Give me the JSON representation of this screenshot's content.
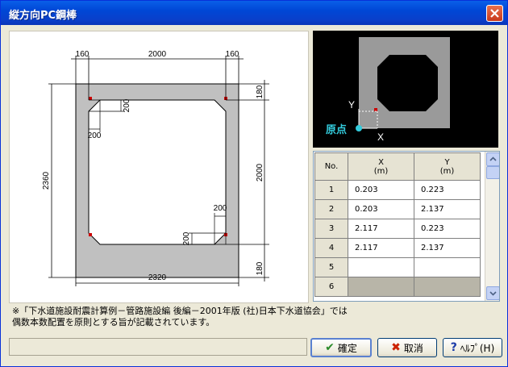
{
  "window": {
    "title": "縦方向PC鋼棒"
  },
  "drawing": {
    "dims": {
      "top_left": "160",
      "top_mid": "2000",
      "top_right": "160",
      "left": "2360",
      "right_top": "180",
      "right_mid": "2000",
      "right_bottom": "180",
      "bottom": "2320",
      "chamfer_tl_v": "200",
      "chamfer_tl_h": "200",
      "chamfer_br_h": "200",
      "chamfer_br_v": "200"
    }
  },
  "preview": {
    "origin_label": "原点",
    "axis_x": "X",
    "axis_y": "Y"
  },
  "table": {
    "headers": {
      "no": "No.",
      "x": "X",
      "x_unit": "(m)",
      "y": "Y",
      "y_unit": "(m)"
    },
    "rows": [
      {
        "no": "1",
        "x": "0.203",
        "y": "0.223"
      },
      {
        "no": "2",
        "x": "0.203",
        "y": "2.137"
      },
      {
        "no": "3",
        "x": "2.117",
        "y": "0.223"
      },
      {
        "no": "4",
        "x": "2.117",
        "y": "2.137"
      },
      {
        "no": "5",
        "x": "",
        "y": ""
      },
      {
        "no": "6",
        "x": "",
        "y": ""
      }
    ]
  },
  "note": {
    "line1": "※「下水道施設耐震計算例－管路施設編 後編－2001年版 (社)日本下水道協会」では",
    "line2": "偶数本数配置を原則とする旨が記載されています。"
  },
  "buttons": {
    "ok": "確定",
    "cancel": "取消",
    "help": "ﾍﾙﾌﾟ(H)"
  },
  "colors": {
    "title_bar": "#0a47d6",
    "section_fill": "#c0c0c0",
    "rebar": "#cc0000",
    "origin": "#33ccdd"
  }
}
